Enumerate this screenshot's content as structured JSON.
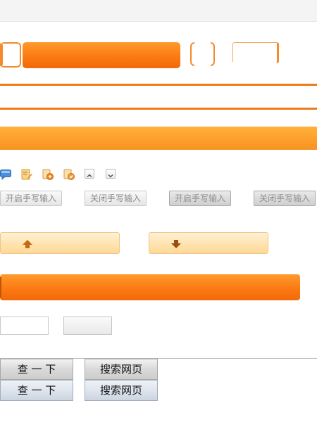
{
  "handwriting_buttons": {
    "open_label_1": "开启手写输入",
    "close_label_1": "关闭手写输入",
    "open_label_2": "开启手写输入",
    "close_label_2": "关闭手写输入"
  },
  "search_buttons": {
    "query_label_1": "查 一 下",
    "search_web_label_1": "搜索网页",
    "query_label_2": "查 一 下",
    "search_web_label_2": "搜索网页"
  },
  "icons": [
    "comment-icon",
    "edit-icon",
    "add-document-icon",
    "check-document-icon",
    "chevron-up-icon",
    "chevron-down-icon",
    "arrow-up-icon",
    "arrow-down-icon"
  ],
  "colors": {
    "accent_orange": "#fb7a12",
    "light_orange": "#ffe2ad",
    "neutral_border": "#c8c8c8"
  }
}
